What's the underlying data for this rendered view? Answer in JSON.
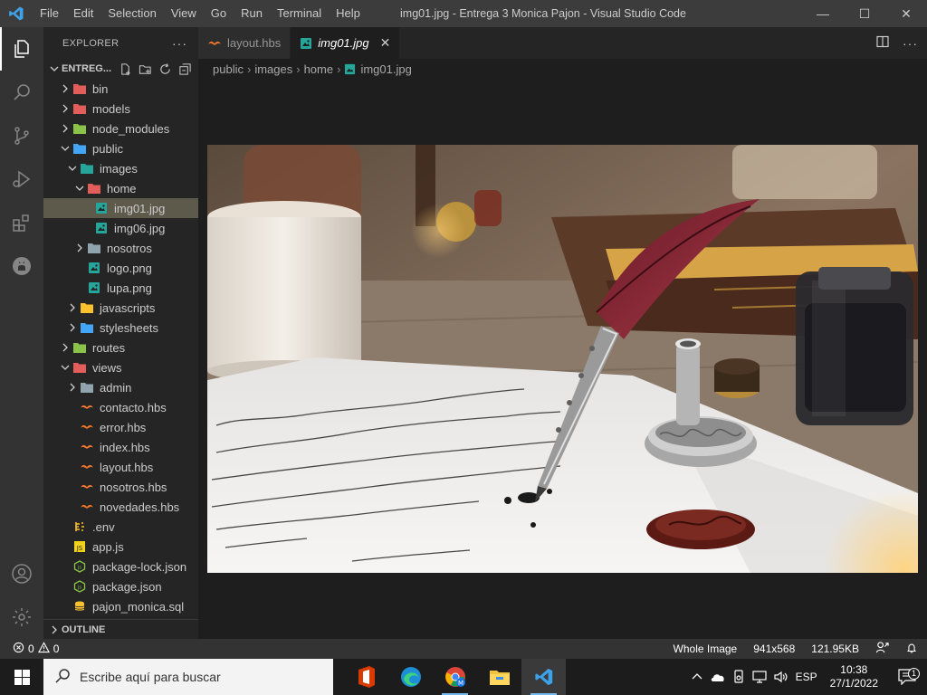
{
  "titlebar": {
    "menu": [
      "File",
      "Edit",
      "Selection",
      "View",
      "Go",
      "Run",
      "Terminal",
      "Help"
    ],
    "title": "img01.jpg - Entrega 3 Monica Pajon - Visual Studio Code",
    "minimize": "—",
    "maximize": "☐",
    "close": "✕"
  },
  "explorer": {
    "header": "EXPLORER",
    "more": "···",
    "section": "ENTREG...",
    "outline": "OUTLINE",
    "tree": [
      {
        "label": "bin",
        "depth": 0,
        "type": "folder",
        "open": false,
        "icon": "folder-red"
      },
      {
        "label": "models",
        "depth": 0,
        "type": "folder",
        "open": false,
        "icon": "folder-red"
      },
      {
        "label": "node_modules",
        "depth": 0,
        "type": "folder",
        "open": false,
        "icon": "folder-green"
      },
      {
        "label": "public",
        "depth": 0,
        "type": "folder",
        "open": true,
        "icon": "folder-blue"
      },
      {
        "label": "images",
        "depth": 1,
        "type": "folder",
        "open": true,
        "icon": "folder-teal"
      },
      {
        "label": "home",
        "depth": 2,
        "type": "folder",
        "open": true,
        "icon": "folder-red"
      },
      {
        "label": "img01.jpg",
        "depth": 3,
        "type": "file",
        "icon": "image",
        "selected": true
      },
      {
        "label": "img06.jpg",
        "depth": 3,
        "type": "file",
        "icon": "image"
      },
      {
        "label": "nosotros",
        "depth": 2,
        "type": "folder",
        "open": false,
        "icon": "folder-gray"
      },
      {
        "label": "logo.png",
        "depth": 2,
        "type": "file",
        "icon": "image"
      },
      {
        "label": "lupa.png",
        "depth": 2,
        "type": "file",
        "icon": "image"
      },
      {
        "label": "javascripts",
        "depth": 1,
        "type": "folder",
        "open": false,
        "icon": "folder-yellow"
      },
      {
        "label": "stylesheets",
        "depth": 1,
        "type": "folder",
        "open": false,
        "icon": "folder-blue"
      },
      {
        "label": "routes",
        "depth": 0,
        "type": "folder",
        "open": false,
        "icon": "folder-green"
      },
      {
        "label": "views",
        "depth": 0,
        "type": "folder",
        "open": true,
        "icon": "folder-red"
      },
      {
        "label": "admin",
        "depth": 1,
        "type": "folder",
        "open": false,
        "icon": "folder-gray"
      },
      {
        "label": "contacto.hbs",
        "depth": 1,
        "type": "file",
        "icon": "hbs"
      },
      {
        "label": "error.hbs",
        "depth": 1,
        "type": "file",
        "icon": "hbs"
      },
      {
        "label": "index.hbs",
        "depth": 1,
        "type": "file",
        "icon": "hbs"
      },
      {
        "label": "layout.hbs",
        "depth": 1,
        "type": "file",
        "icon": "hbs"
      },
      {
        "label": "nosotros.hbs",
        "depth": 1,
        "type": "file",
        "icon": "hbs"
      },
      {
        "label": "novedades.hbs",
        "depth": 1,
        "type": "file",
        "icon": "hbs"
      },
      {
        "label": ".env",
        "depth": 0,
        "type": "file",
        "icon": "env"
      },
      {
        "label": "app.js",
        "depth": 0,
        "type": "file",
        "icon": "js"
      },
      {
        "label": "package-lock.json",
        "depth": 0,
        "type": "file",
        "icon": "node"
      },
      {
        "label": "package.json",
        "depth": 0,
        "type": "file",
        "icon": "node"
      },
      {
        "label": "pajon_monica.sql",
        "depth": 0,
        "type": "file",
        "icon": "sql"
      }
    ]
  },
  "tabs": [
    {
      "label": "layout.hbs",
      "active": false
    },
    {
      "label": "img01.jpg",
      "active": true,
      "close": "✕"
    }
  ],
  "breadcrumb": [
    "public",
    "images",
    "home",
    "img01.jpg"
  ],
  "statusbar": {
    "errors": "0",
    "warnings": "0",
    "zoom": "Whole Image",
    "dimensions": "941x568",
    "size": "121.95KB"
  },
  "taskbar": {
    "search_placeholder": "Escribe aquí para buscar",
    "lang": "ESP",
    "time": "10:38",
    "date": "27/1/2022",
    "notifications": "1"
  }
}
